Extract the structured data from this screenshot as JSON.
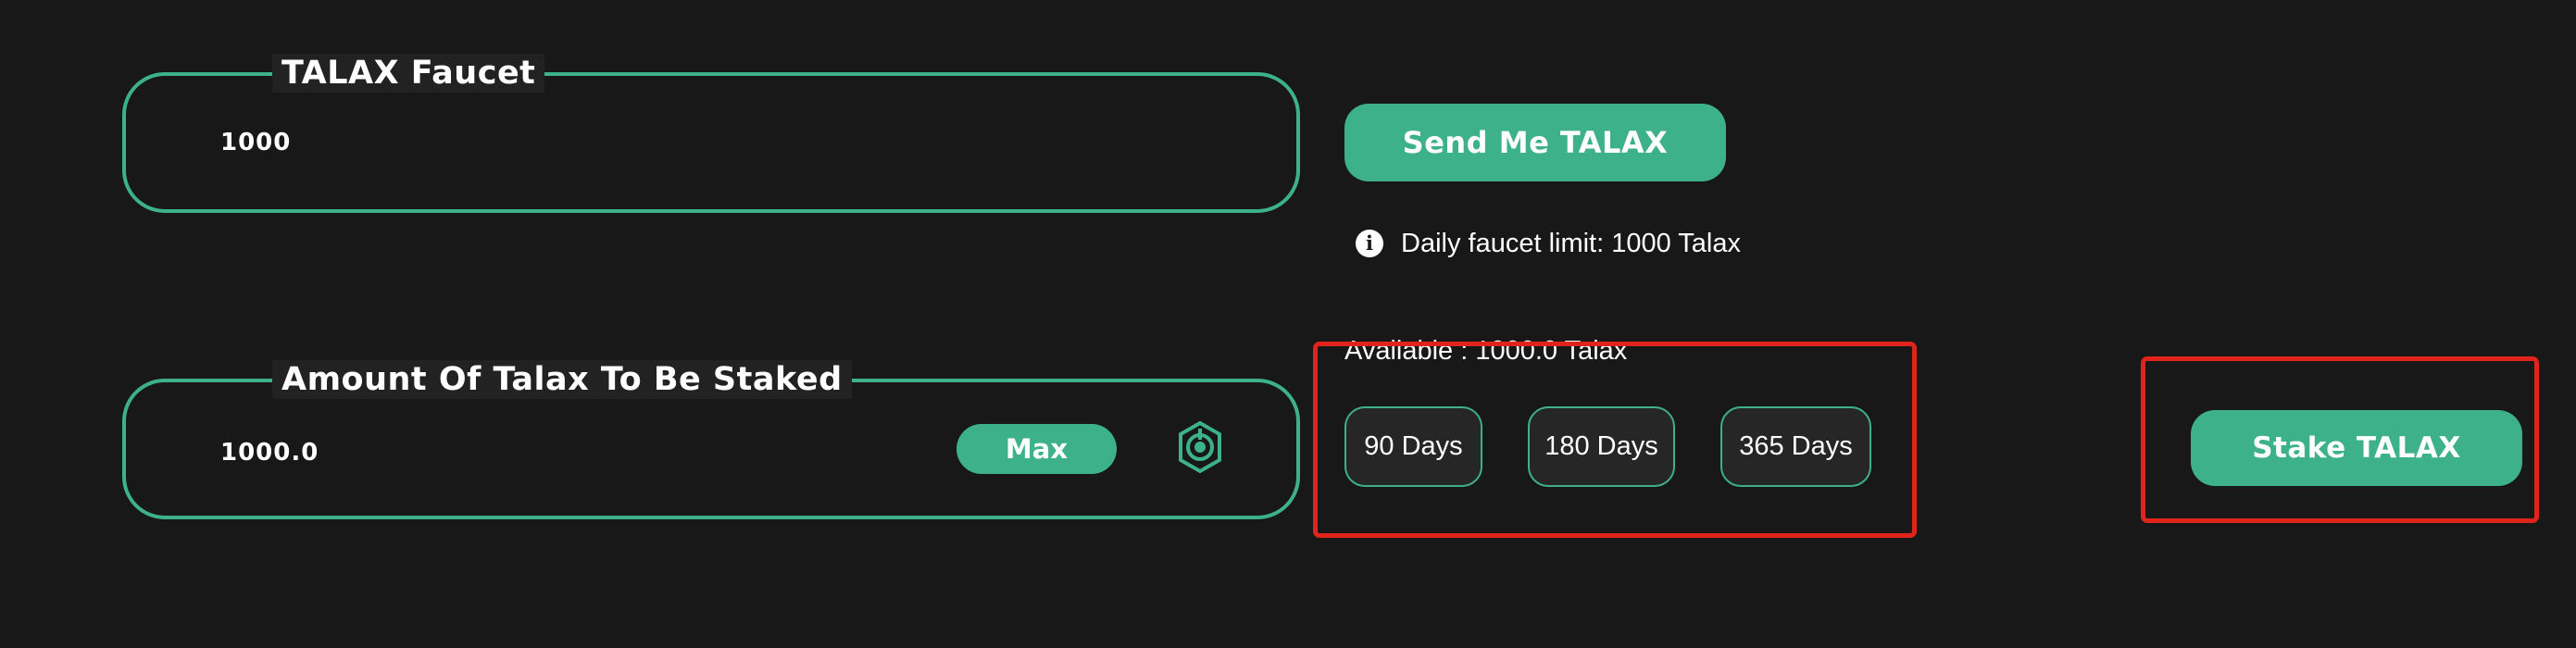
{
  "faucet": {
    "legend": "TALAX Faucet",
    "value": "1000",
    "send_button_label": "Send Me TALAX",
    "limit_text": "Daily faucet limit: 1000 Talax",
    "info_icon_glyph": "i"
  },
  "staking": {
    "legend": "Amount Of Talax To Be Staked",
    "value": "1000.0",
    "max_button_label": "Max",
    "available_text": "Available : 1000.0 Talax",
    "durations": [
      {
        "label": "90 Days"
      },
      {
        "label": "180 Days"
      },
      {
        "label": "365 Days"
      }
    ],
    "stake_button_label": "Stake TALAX"
  },
  "icons": {
    "info": "info-icon",
    "token": "talax-token-icon"
  },
  "colors": {
    "background": "#181818",
    "accent": "#3db28a",
    "highlight": "#e0231b",
    "text": "#ffffff"
  }
}
